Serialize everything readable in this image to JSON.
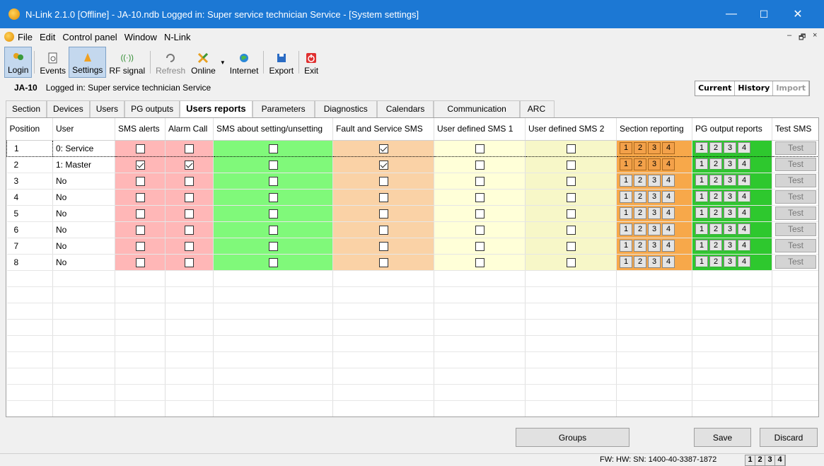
{
  "window": {
    "title": "N-Link 2.1.0 [Offline] - JA-10.ndb Logged in: Super service technician Service - [System settings]",
    "minimize": "—",
    "maximize": "☐",
    "close": "✕"
  },
  "menu": {
    "items": [
      "File",
      "Edit",
      "Control panel",
      "Window",
      "N-Link"
    ],
    "mdi_minimize": "–",
    "mdi_restore": "🗗",
    "mdi_close": "×"
  },
  "toolbar": {
    "login": "Login",
    "events": "Events",
    "settings": "Settings",
    "rf_signal": "RF signal",
    "refresh": "Refresh",
    "online": "Online",
    "internet": "Internet",
    "export": "Export",
    "exit": "Exit"
  },
  "device": {
    "name": "JA-10",
    "logged_in": "Logged in: Super service technician Service"
  },
  "view_tabs": {
    "current": "Current",
    "history": "History",
    "import": "Import"
  },
  "tabs": [
    "Section",
    "Devices",
    "Users",
    "PG outputs",
    "Users reports",
    "Parameters",
    "Diagnostics",
    "Calendars",
    "Communication",
    "ARC"
  ],
  "active_tab": "Users reports",
  "grid": {
    "columns": [
      "Position",
      "User",
      "SMS alerts",
      "Alarm Call",
      "SMS about setting/unsetting",
      "Fault and Service SMS",
      "User defined SMS 1",
      "User defined SMS 2",
      "Section reporting",
      "PG output reports",
      "Test SMS"
    ],
    "segments": [
      "1",
      "2",
      "3",
      "4"
    ],
    "test_label": "Test",
    "rows": [
      {
        "position": "1",
        "user": "0: Service",
        "sms_alerts": false,
        "alarm_call": false,
        "sms_setting": false,
        "fault_service": true,
        "user_sms1": false,
        "user_sms2": false,
        "section_on": true
      },
      {
        "position": "2",
        "user": "1: Master",
        "sms_alerts": true,
        "alarm_call": true,
        "sms_setting": false,
        "fault_service": true,
        "user_sms1": false,
        "user_sms2": false,
        "section_on": true
      },
      {
        "position": "3",
        "user": "No",
        "sms_alerts": false,
        "alarm_call": false,
        "sms_setting": false,
        "fault_service": false,
        "user_sms1": false,
        "user_sms2": false,
        "section_on": false
      },
      {
        "position": "4",
        "user": "No",
        "sms_alerts": false,
        "alarm_call": false,
        "sms_setting": false,
        "fault_service": false,
        "user_sms1": false,
        "user_sms2": false,
        "section_on": false
      },
      {
        "position": "5",
        "user": "No",
        "sms_alerts": false,
        "alarm_call": false,
        "sms_setting": false,
        "fault_service": false,
        "user_sms1": false,
        "user_sms2": false,
        "section_on": false
      },
      {
        "position": "6",
        "user": "No",
        "sms_alerts": false,
        "alarm_call": false,
        "sms_setting": false,
        "fault_service": false,
        "user_sms1": false,
        "user_sms2": false,
        "section_on": false
      },
      {
        "position": "7",
        "user": "No",
        "sms_alerts": false,
        "alarm_call": false,
        "sms_setting": false,
        "fault_service": false,
        "user_sms1": false,
        "user_sms2": false,
        "section_on": false
      },
      {
        "position": "8",
        "user": "No",
        "sms_alerts": false,
        "alarm_call": false,
        "sms_setting": false,
        "fault_service": false,
        "user_sms1": false,
        "user_sms2": false,
        "section_on": false
      }
    ]
  },
  "buttons": {
    "groups": "Groups",
    "save": "Save",
    "discard": "Discard"
  },
  "status": {
    "fw_line": "FW:  HW:  SN: 1400-40-3387-1872",
    "segments": [
      "1",
      "2",
      "3",
      "4"
    ]
  },
  "colors": {
    "titlebar": "#1c78d4",
    "sms_alerts": "#ffb7b7",
    "sms_setting": "#80f97a",
    "fault_service": "#fad2a6",
    "user_sms1": "#ffffd8",
    "user_sms2": "#f7f7c8",
    "section_reporting": "#f7a84a",
    "pg_output": "#2ec82e"
  }
}
